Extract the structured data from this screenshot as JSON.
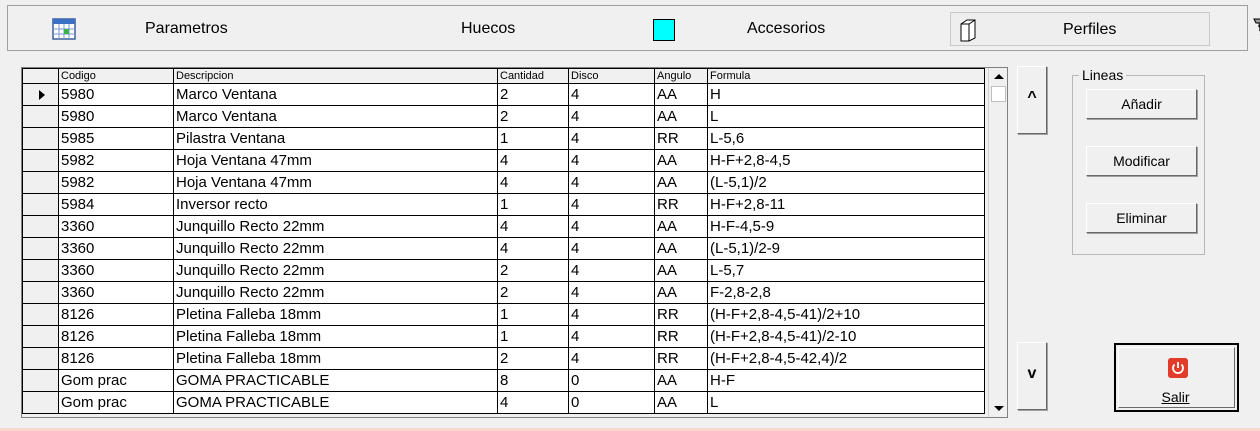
{
  "tabs": [
    {
      "label": "Parametros",
      "icon": "calendar-grid-icon"
    },
    {
      "label": "Huecos",
      "icon": "cyan-square-icon"
    },
    {
      "label": "Accesorios",
      "icon": "screw-icon"
    },
    {
      "label": "Perfiles",
      "icon": "profile-box-icon",
      "selected": true
    }
  ],
  "grid": {
    "columns": [
      "Codigo",
      "Descripcion",
      "Cantidad",
      "Disco",
      "Angulo",
      "Formula"
    ],
    "rows": [
      [
        "5980",
        "Marco Ventana",
        "2",
        "4",
        "AA",
        "H"
      ],
      [
        "5980",
        "Marco Ventana",
        "2",
        "4",
        "AA",
        "L"
      ],
      [
        "5985",
        "Pilastra Ventana",
        "1",
        "4",
        "RR",
        "L-5,6"
      ],
      [
        "5982",
        "Hoja Ventana 47mm",
        "4",
        "4",
        "AA",
        "H-F+2,8-4,5"
      ],
      [
        "5982",
        "Hoja Ventana 47mm",
        "4",
        "4",
        "AA",
        "(L-5,1)/2"
      ],
      [
        "5984",
        "Inversor recto",
        "1",
        "4",
        "RR",
        "H-F+2,8-11"
      ],
      [
        "3360",
        "Junquillo Recto 22mm",
        "4",
        "4",
        "AA",
        "H-F-4,5-9"
      ],
      [
        "3360",
        "Junquillo Recto 22mm",
        "4",
        "4",
        "AA",
        "(L-5,1)/2-9"
      ],
      [
        "3360",
        "Junquillo Recto 22mm",
        "2",
        "4",
        "AA",
        "L-5,7"
      ],
      [
        "3360",
        "Junquillo Recto 22mm",
        "2",
        "4",
        "AA",
        "F-2,8-2,8"
      ],
      [
        "8126",
        "Pletina Falleba 18mm",
        "1",
        "4",
        "RR",
        "(H-F+2,8-4,5-41)/2+10"
      ],
      [
        "8126",
        "Pletina Falleba 18mm",
        "1",
        "4",
        "RR",
        "(H-F+2,8-4,5-41)/2-10"
      ],
      [
        "8126",
        "Pletina Falleba 18mm",
        "2",
        "4",
        "RR",
        "(H-F+2,8-4,5-42,4)/2"
      ],
      [
        "Gom prac",
        "GOMA PRACTICABLE",
        "8",
        "0",
        "AA",
        "H-F"
      ],
      [
        "Gom prac",
        "GOMA PRACTICABLE",
        "4",
        "0",
        "AA",
        "L"
      ]
    ],
    "current_row": 0
  },
  "nav": {
    "up_label": "^",
    "down_label": "v"
  },
  "lineas": {
    "title": "Lineas",
    "add_label": "Añadir",
    "modify_label": "Modificar",
    "delete_label": "Eliminar"
  },
  "exit": {
    "label": "Salir",
    "icon": "power-icon"
  },
  "colors": {
    "accent_cyan": "#00ffff",
    "exit_icon_red": "#e23b2a"
  }
}
